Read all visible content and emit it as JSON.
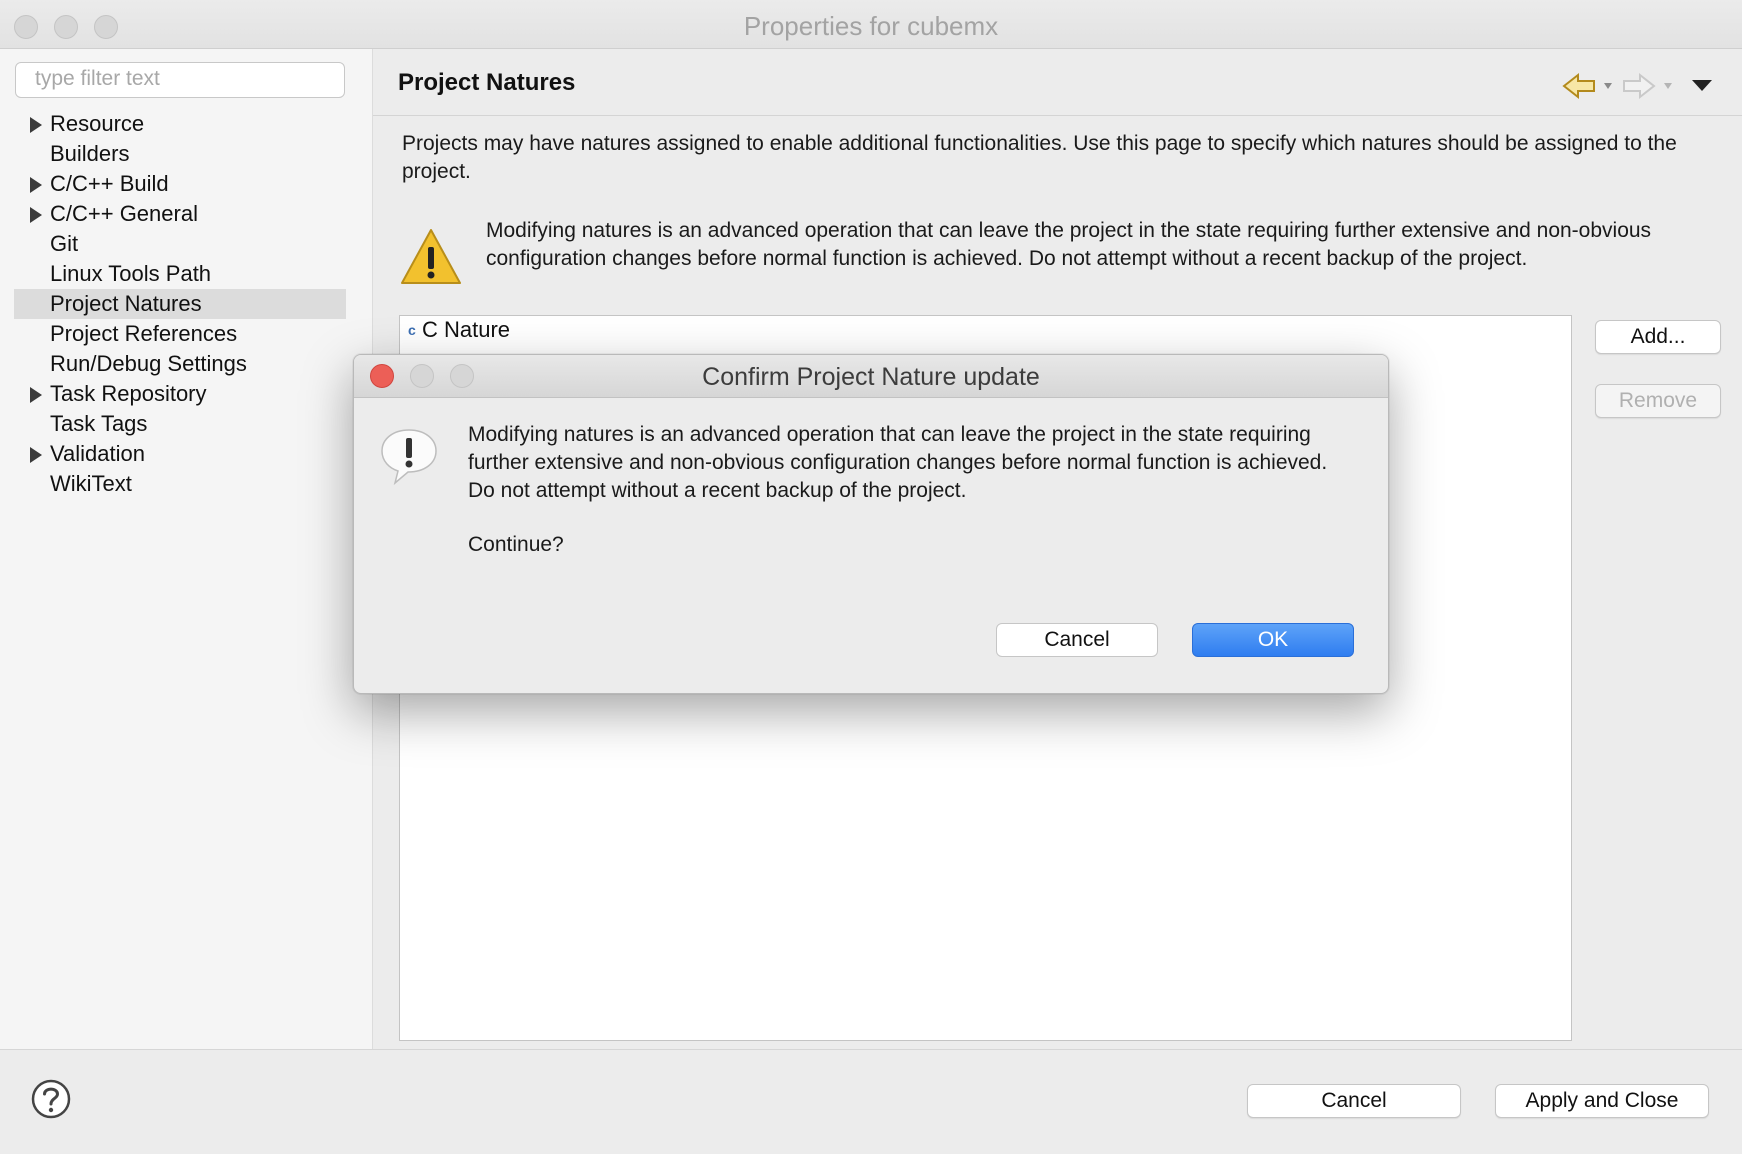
{
  "window": {
    "title": "Properties for cubemx"
  },
  "filter": {
    "placeholder": "type filter text"
  },
  "tree": {
    "items": [
      {
        "label": "Resource",
        "expandable": true,
        "selected": false
      },
      {
        "label": "Builders",
        "expandable": false,
        "selected": false
      },
      {
        "label": "C/C++ Build",
        "expandable": true,
        "selected": false
      },
      {
        "label": "C/C++ General",
        "expandable": true,
        "selected": false
      },
      {
        "label": "Git",
        "expandable": false,
        "selected": false
      },
      {
        "label": "Linux Tools Path",
        "expandable": false,
        "selected": false
      },
      {
        "label": "Project Natures",
        "expandable": false,
        "selected": true
      },
      {
        "label": "Project References",
        "expandable": false,
        "selected": false
      },
      {
        "label": "Run/Debug Settings",
        "expandable": false,
        "selected": false
      },
      {
        "label": "Task Repository",
        "expandable": true,
        "selected": false
      },
      {
        "label": "Task Tags",
        "expandable": false,
        "selected": false
      },
      {
        "label": "Validation",
        "expandable": true,
        "selected": false
      },
      {
        "label": "WikiText",
        "expandable": false,
        "selected": false
      }
    ]
  },
  "page": {
    "title": "Project Natures",
    "description": "Projects may have natures assigned to enable additional functionalities. Use this page to specify which natures should be assigned to the project.",
    "warning": "Modifying natures is an advanced operation that can leave the project in the state requiring further extensive and non-obvious configuration changes before normal function is achieved. Do not attempt without a recent backup of the project.",
    "natures": [
      "C Nature"
    ],
    "add_label": "Add...",
    "remove_label": "Remove"
  },
  "bottom": {
    "cancel_label": "Cancel",
    "apply_close_label": "Apply and Close"
  },
  "dialog": {
    "title": "Confirm Project Nature update",
    "message": "Modifying natures is an advanced operation that can leave the project in the state requiring further extensive and non-obvious configuration changes before normal function is achieved. Do not attempt without a recent backup of the project.",
    "question": "Continue?",
    "cancel_label": "Cancel",
    "ok_label": "OK"
  },
  "colors": {
    "accent": "#2f7df0",
    "selection": "#dcdcdc",
    "close_red": "#ec5f57",
    "warning_yellow": "#f2c12e"
  },
  "icons": [
    "back-arrow-icon",
    "forward-arrow-icon",
    "menu-dropdown-icon",
    "warning-icon",
    "c-nature-icon",
    "help-icon",
    "alert-icon"
  ]
}
